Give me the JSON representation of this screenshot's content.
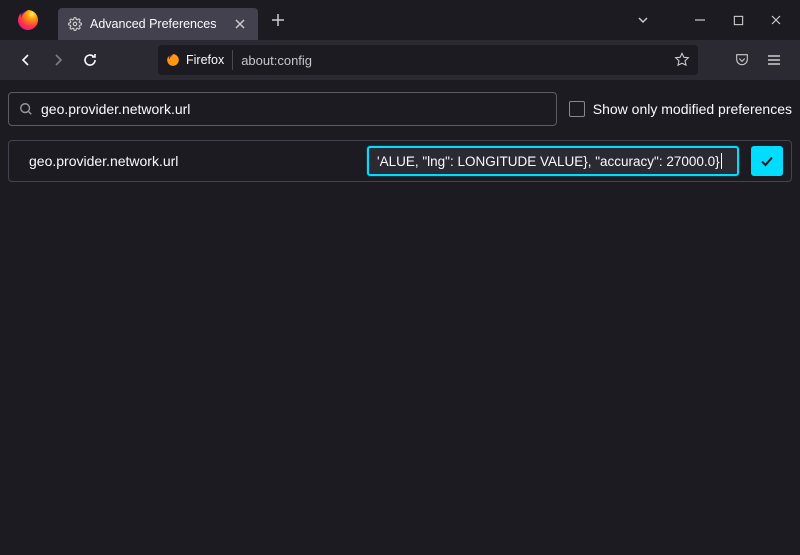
{
  "window": {
    "tab_title": "Advanced Preferences"
  },
  "urlbar": {
    "identity_label": "Firefox",
    "address": "about:config"
  },
  "search": {
    "value": "geo.provider.network.url",
    "show_modified_label": "Show only modified preferences",
    "show_modified_checked": false
  },
  "pref": {
    "name": "geo.provider.network.url",
    "value_display": "'ALUE, \"lng\": LONGITUDE VALUE}, \"accuracy\": 27000.0}"
  }
}
